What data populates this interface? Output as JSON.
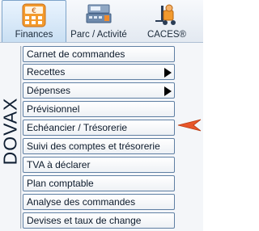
{
  "tabs": [
    {
      "label": "Finances",
      "icon": "calculator-euro-icon",
      "active": true
    },
    {
      "label": "Parc / Activité",
      "icon": "cash-register-icon",
      "active": false
    },
    {
      "label": "CACES®",
      "icon": "forklift-icon",
      "active": false
    }
  ],
  "panel": {
    "title": "DOVAX",
    "items": [
      {
        "label": "Carnet de commandes",
        "submenu": false
      },
      {
        "label": "Recettes",
        "submenu": true
      },
      {
        "label": "Dépenses",
        "submenu": true
      },
      {
        "label": "Prévisionnel",
        "submenu": false
      },
      {
        "label": "Echéancier / Trésorerie",
        "submenu": false
      },
      {
        "label": "Suivi des comptes et trésorerie",
        "submenu": false
      },
      {
        "label": "TVA à déclarer",
        "submenu": false
      },
      {
        "label": "Plan comptable",
        "submenu": false
      },
      {
        "label": "Analyse des commandes",
        "submenu": false
      },
      {
        "label": "Devises et taux de change",
        "submenu": false
      }
    ],
    "pointer_target": "Echéancier / Trésorerie",
    "pointer_color": "#e8562a"
  },
  "colors": {
    "accent": "#f29a2e",
    "border": "#5f7fa3"
  }
}
